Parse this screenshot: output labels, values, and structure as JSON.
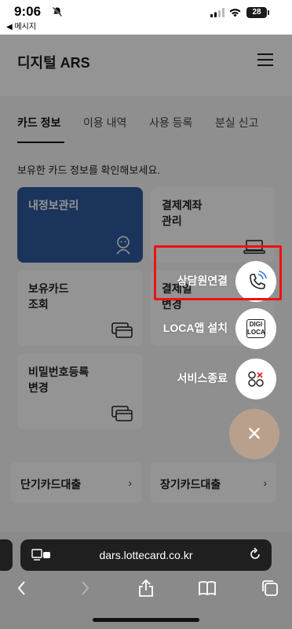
{
  "status_bar": {
    "time": "9:06",
    "back_app": "◀ 메시지",
    "battery": "28"
  },
  "header": {
    "title": "디지털 ARS"
  },
  "tabs": [
    {
      "label": "카드 정보",
      "active": true
    },
    {
      "label": "이용 내역",
      "active": false
    },
    {
      "label": "사용 등록",
      "active": false
    },
    {
      "label": "분실 신고",
      "active": false
    }
  ],
  "intro_text": "보유한 카드 정보를 확인해보세요.",
  "cards": [
    {
      "label": "내정보관리",
      "icon": "person-icon"
    },
    {
      "label": "결제계좌\n관리",
      "icon": "laptop-icon"
    },
    {
      "label": "보유카드\n조회",
      "icon": "cards-icon"
    },
    {
      "label": "결제일\n변경",
      "icon": "calendar-icon"
    },
    {
      "label": "비밀번호등록\n변경",
      "icon": "cards-icon"
    }
  ],
  "loans": [
    {
      "label": "단기카드대출",
      "chevron": "›"
    },
    {
      "label": "장기카드대출",
      "chevron": "›"
    }
  ],
  "fab_menu": {
    "items": [
      {
        "label": "상담원연결",
        "icon": "phone-call-icon"
      },
      {
        "label": "LOCA앱 설치",
        "icon": "digi-loca-icon",
        "icon_text_1": "DIGI",
        "icon_text_2": "LOCA"
      },
      {
        "label": "서비스종료",
        "icon": "service-end-icon"
      }
    ],
    "close_symbol": "×",
    "accent": "#b9a08d"
  },
  "browser": {
    "url": "dars.lottecard.co.kr"
  },
  "colors": {
    "primary_card": "#2f5a9e",
    "highlight": "#ee1111"
  }
}
